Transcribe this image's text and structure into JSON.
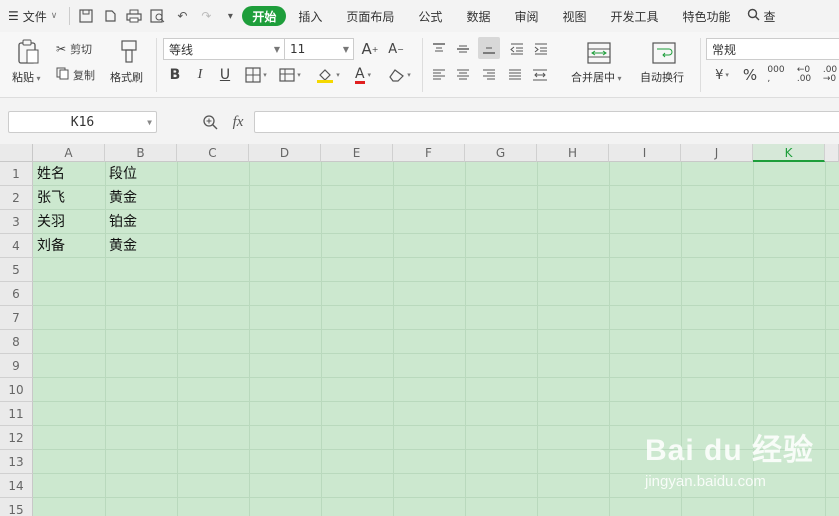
{
  "menu": {
    "file_label": "文件",
    "tabs": [
      "开始",
      "插入",
      "页面布局",
      "公式",
      "数据",
      "审阅",
      "视图",
      "开发工具",
      "特色功能"
    ],
    "search_label": "查"
  },
  "ribbon": {
    "paste_label": "粘贴",
    "cut_label": "剪切",
    "copy_label": "复制",
    "format_painter_label": "格式刷",
    "font_name": "等线",
    "font_size": "11",
    "bold": "B",
    "italic": "I",
    "underline": "U",
    "merge_label": "合并居中",
    "wrap_label": "自动换行",
    "number_format": "常规",
    "percent": "%"
  },
  "formula_bar": {
    "cell_ref": "K16",
    "fx": "fx",
    "value": ""
  },
  "sheet": {
    "columns": [
      "A",
      "B",
      "C",
      "D",
      "E",
      "F",
      "G",
      "H",
      "I",
      "J",
      "K"
    ],
    "selected_column": "K",
    "rows": [
      "1",
      "2",
      "3",
      "4",
      "5",
      "6",
      "7",
      "8",
      "9",
      "10",
      "11",
      "12",
      "13",
      "14",
      "15"
    ],
    "cells": [
      [
        "姓名",
        "段位"
      ],
      [
        "张飞",
        "黄金"
      ],
      [
        "关羽",
        "铂金"
      ],
      [
        "刘备",
        "黄金"
      ]
    ]
  },
  "colors": {
    "accent": "#1e9e3b",
    "sheet_bg": "#cce8cf"
  },
  "watermark": {
    "logo": "Bai du 经验",
    "url": "jingyan.baidu.com"
  }
}
